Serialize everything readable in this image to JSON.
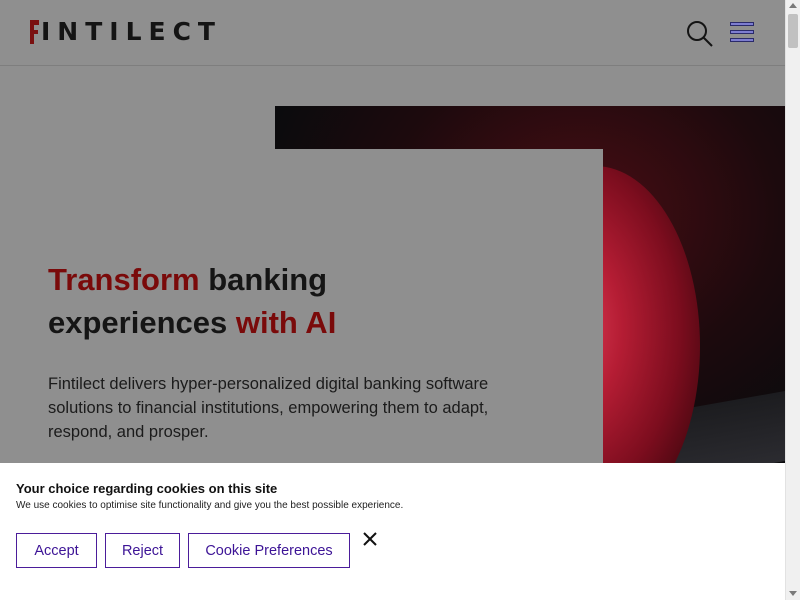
{
  "header": {
    "logo_text": "INTILECT",
    "brand_color": "#7a1010",
    "search_icon": "search-icon",
    "menu_icon": "hamburger-menu-icon"
  },
  "hero": {
    "headline_part1": "Transform",
    "headline_part2": " banking",
    "headline_part3": "experiences ",
    "headline_part4": "with AI",
    "accent_color": "#7a0a0a",
    "description": "Fintilect delivers hyper-personalized digital banking software solutions to financial institutions, empowering them to adapt, respond, and prosper."
  },
  "cookie_banner": {
    "title": "Your choice regarding cookies on this site",
    "text": "We use cookies to optimise site functionality and give you the best possible experience.",
    "accept_label": "Accept",
    "reject_label": "Reject",
    "preferences_label": "Cookie Preferences",
    "button_color": "#3d1496",
    "close_icon": "close-icon"
  }
}
